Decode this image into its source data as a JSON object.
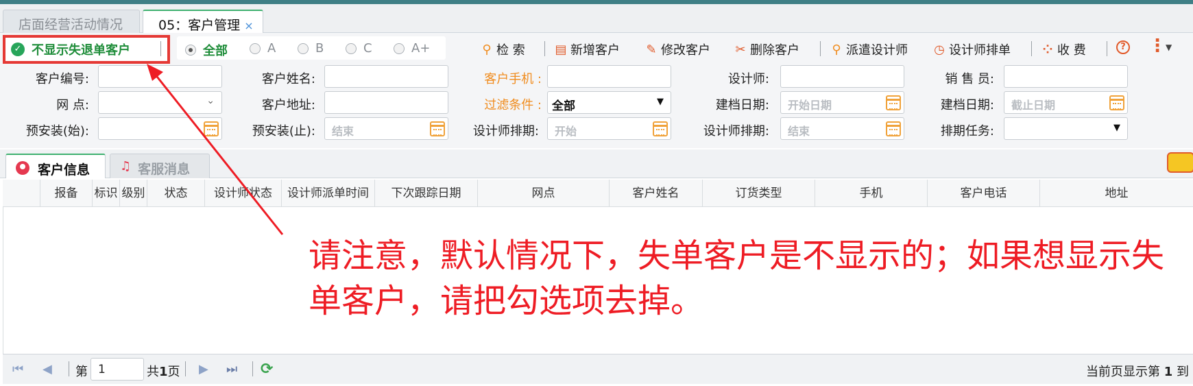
{
  "page_tabs": [
    {
      "label": "店面经营活动情况"
    },
    {
      "label": "05：客户管理",
      "close": "×"
    }
  ],
  "toolbar": {
    "hide_lost_checkbox": {
      "label": "不显示失退单客户",
      "checked": true
    },
    "level_filter": {
      "options": [
        "全部",
        "A",
        "B",
        "C",
        "A+"
      ],
      "selected": "全部"
    },
    "buttons": [
      {
        "label": "检 索",
        "icon": "search-icon"
      },
      {
        "label": "新增客户",
        "icon": "add-file-icon"
      },
      {
        "label": "修改客户",
        "icon": "pencil-icon"
      },
      {
        "label": "删除客户",
        "icon": "scissors-icon"
      },
      {
        "label": "派遣设计师",
        "icon": "dispatch-icon"
      },
      {
        "label": "设计师排单",
        "icon": "alarm-clock-icon"
      },
      {
        "label": "收 费",
        "icon": "fee-icon"
      }
    ],
    "help_glyph": "?",
    "more_glyph": "⋮"
  },
  "form": {
    "customer_no": {
      "label": "客户编号:"
    },
    "customer_name": {
      "label": "客户姓名:"
    },
    "customer_mobile": {
      "label": "客户手机 :"
    },
    "designer": {
      "label": "设计师:"
    },
    "sales": {
      "label": "销 售 员:"
    },
    "outlet": {
      "label": "网 点:"
    },
    "customer_address": {
      "label": "客户地址:"
    },
    "filter_condition": {
      "label": "过滤条件 :",
      "value": "全部"
    },
    "created_date_from": {
      "label": "建档日期:",
      "placeholder": "开始日期"
    },
    "created_date_to": {
      "label": "建档日期:",
      "placeholder": "截止日期"
    },
    "preinstall_start": {
      "label": "预安装(始):"
    },
    "preinstall_end": {
      "label": "预安装(止):",
      "placeholder": "结束"
    },
    "designer_schedule_start": {
      "label": "设计师排期:",
      "placeholder": "开始"
    },
    "designer_schedule_end": {
      "label": "设计师排期:",
      "placeholder": "结束"
    },
    "schedule_task": {
      "label": "排期任务:"
    }
  },
  "inner_tabs": [
    {
      "label": "客户信息",
      "icon": "user-icon"
    },
    {
      "label": "客服消息",
      "icon": "bell-icon"
    }
  ],
  "grid": {
    "columns": [
      "报备",
      "标识",
      "级别",
      "状态",
      "设计师状态",
      "设计师派单时间",
      "下次跟踪日期",
      "网点",
      "客户姓名",
      "订货类型",
      "手机",
      "客户电话",
      "地址"
    ],
    "rows": []
  },
  "pager": {
    "page_prefix": "第",
    "page_value": "1",
    "total_prefix": "共",
    "total_pages": "1",
    "total_suffix": "页",
    "display_prefix": "当前页显示第",
    "display_from": "1",
    "display_to_prefix": "到"
  },
  "annotation": {
    "line1": "请注意，默认情况下，失单客户是不显示的；如果想显示失",
    "line2": "单客户，请把勾选项去掉。"
  },
  "colors": {
    "accent_green": "#1f8d3a",
    "highlight_red": "#e53935",
    "annotation_red": "#ee1c24",
    "label_orange": "#f08c1e"
  }
}
